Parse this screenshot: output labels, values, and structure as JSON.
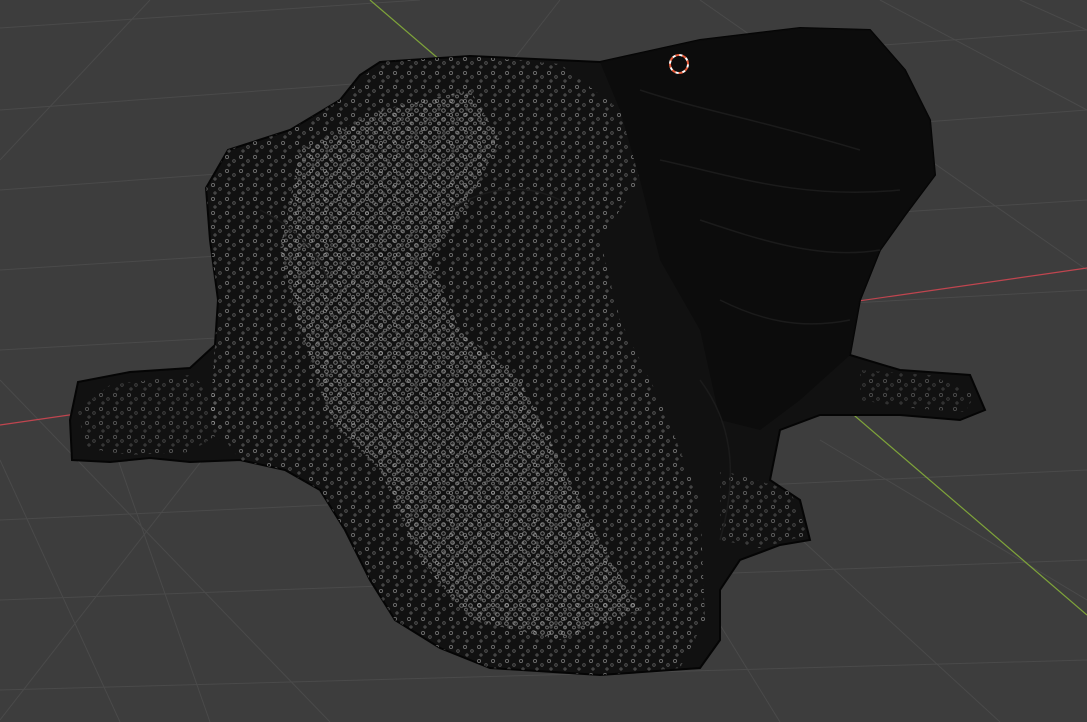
{
  "viewport": {
    "view": "3d-viewport-perspective",
    "shading": "solid-wireframe-overlay",
    "background_color": "#3d3d3d",
    "grid_color": "#4a4a4a",
    "x_axis_color": "#c0454f",
    "y_axis_color": "#7ea33a",
    "mesh_color": "#111111",
    "wireframe_color": "#b9b9b9",
    "cursor_color": "#e35a3a",
    "objects": [
      "sculpted-rock-mesh"
    ],
    "icons": [
      "3d-cursor-icon"
    ]
  }
}
